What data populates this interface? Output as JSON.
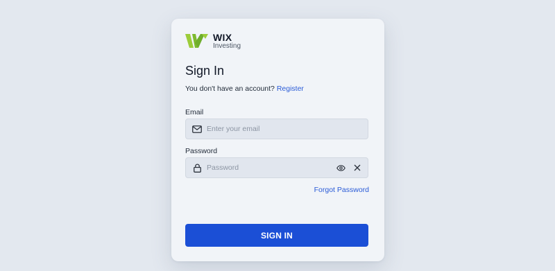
{
  "brand": {
    "name": "WIX",
    "subtitle": "Investing",
    "logo_colors": [
      "#9ccc3a",
      "#6fae2c"
    ]
  },
  "signin": {
    "title": "Sign In",
    "register_prompt": "You don't have an account?",
    "register_link": "Register",
    "email": {
      "label": "Email",
      "placeholder": "Enter your email",
      "value": "",
      "icon": "envelope-icon"
    },
    "password": {
      "label": "Password",
      "placeholder": "Password",
      "value": "",
      "icon": "lock-icon",
      "toggle_icon": "eye-icon",
      "clear_icon": "close-icon"
    },
    "forgot_link": "Forgot Password",
    "submit_label": "SIGN IN"
  },
  "colors": {
    "page_background": "#e3e8ef",
    "card_background": "#f1f4f8",
    "input_background": "#e1e6ee",
    "link": "#2a5bd7",
    "primary_button": "#1b4fd6"
  }
}
